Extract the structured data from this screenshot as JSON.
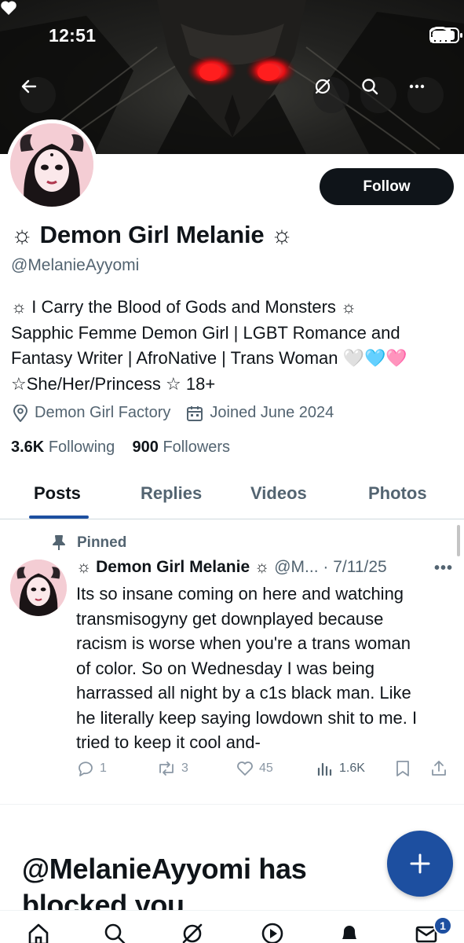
{
  "status_bar": {
    "time": "12:51"
  },
  "profile": {
    "follow_label": "Follow",
    "name_text": "Demon Girl Melanie",
    "name_deco": "☼",
    "handle": "@MelanieAyyomi",
    "bio_lines": [
      "☼ I Carry the Blood of Gods and Monsters ☼",
      "Sapphic Femme Demon Girl | LGBT Romance and",
      "Fantasy Writer | AfroNative | Trans Woman 🤍🩵🩷",
      "☆She/Her/Princess ☆ 18+"
    ],
    "location": "Demon Girl Factory",
    "joined": "Joined June 2024",
    "following_count": "3.6K",
    "following_label": "Following",
    "followers_count": "900",
    "followers_label": "Followers"
  },
  "tabs": [
    {
      "label": "Posts",
      "active": true
    },
    {
      "label": "Replies",
      "active": false
    },
    {
      "label": "Videos",
      "active": false
    },
    {
      "label": "Photos",
      "active": false
    }
  ],
  "pinned_tweet": {
    "pinned_label": "Pinned",
    "author_name": "☼ Demon Girl Melanie ☼",
    "handle_date": "@M... · 7/11/25",
    "more": "•••",
    "text_lines": [
      "Its so insane coming on here and watching",
      "transmisogyny get downplayed because",
      "racism is worse when you're a trans woman",
      "of color. So on Wednesday I was being",
      "harrassed all night by a c1s black man. Like",
      "he literally keep saying lowdown shit to me. I",
      "tried to keep it cool and-"
    ],
    "replies": "1",
    "reposts": "3",
    "likes": "45",
    "views": "1.6K"
  },
  "blocked_notice": {
    "line1": "@MelanieAyyomi has",
    "line2": "blocked you"
  },
  "bottom_nav": {
    "messages_badge": "1"
  },
  "colors": {
    "accent": "#1d4fa0",
    "text": "#0f1419",
    "muted": "#536471",
    "eye_red": "#ff2a2a"
  }
}
